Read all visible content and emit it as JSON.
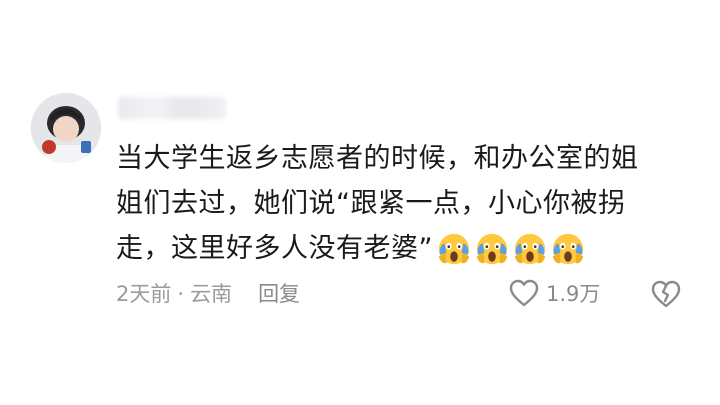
{
  "comment": {
    "content_lines": [
      "当大学生返乡志愿者的时候，和办公室的姐",
      "姐们去过，她们说“跟紧一点，小心你被拐",
      "走，这里好多人没有老婆”"
    ],
    "emojis": [
      "scream-emoji",
      "scream-emoji",
      "scream-emoji",
      "scream-emoji"
    ],
    "time": "2天前",
    "separator": "·",
    "location": "云南",
    "reply_label": "回复",
    "like_count": "1.9万"
  },
  "icons": {
    "like": "heart-outline-icon",
    "dislike": "broken-heart-icon"
  },
  "colors": {
    "text": "#1a1a1a",
    "meta": "#9b9b9b",
    "icon": "#8a8a8a"
  }
}
